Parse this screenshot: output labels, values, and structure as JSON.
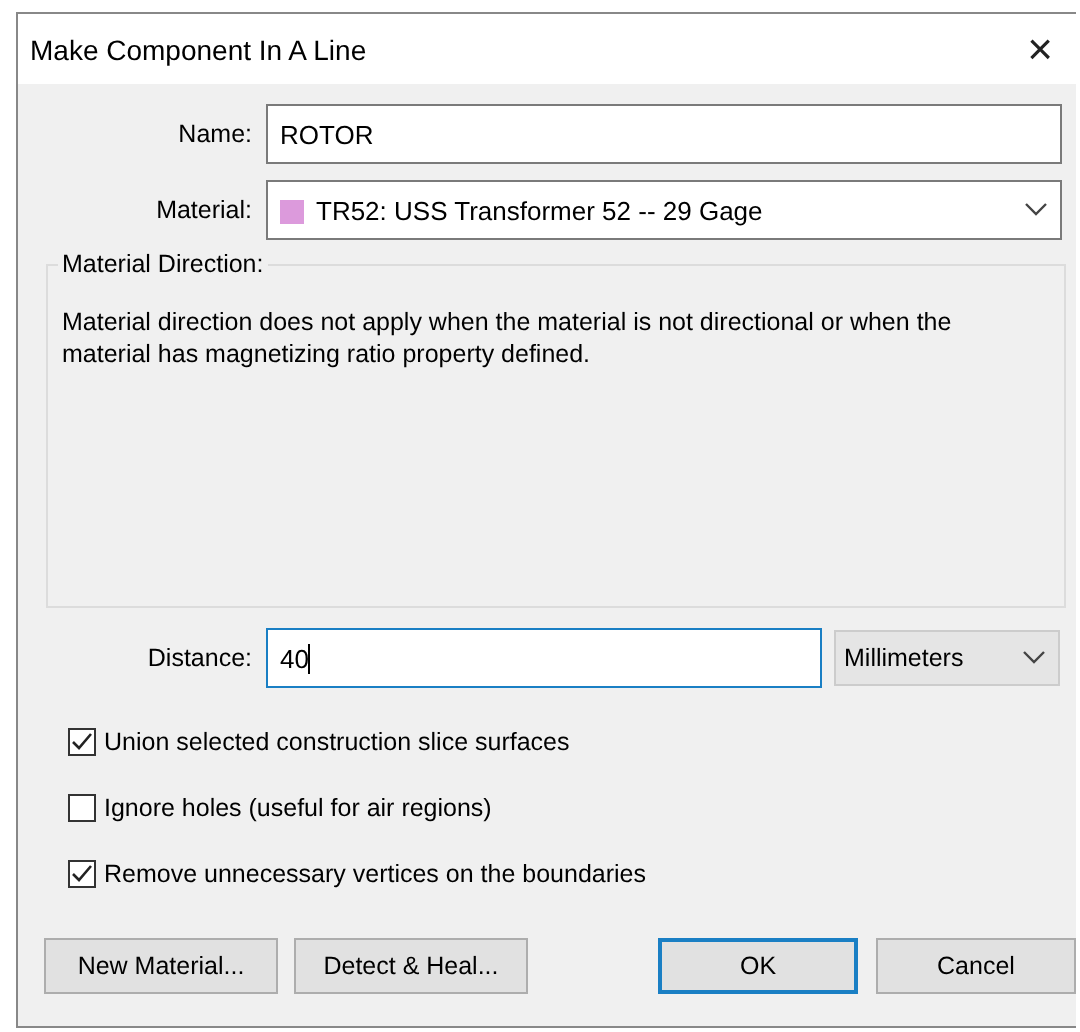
{
  "window": {
    "title": "Make Component In A Line",
    "close": "×"
  },
  "name": {
    "label": "Name:",
    "value": "ROTOR"
  },
  "material": {
    "label": "Material:",
    "value": "TR52: USS Transformer 52 -- 29 Gage",
    "color": "#dc9adc"
  },
  "material_direction": {
    "title": "Material Direction:",
    "text": "Material direction does not apply when the material is not directional or when the material has magnetizing ratio property defined."
  },
  "distance": {
    "label": "Distance:",
    "value": "40",
    "focused": true,
    "unit": "Millimeters"
  },
  "options": [
    {
      "label": "Union selected construction slice surfaces",
      "checked": true
    },
    {
      "label": "Ignore holes (useful for air regions)",
      "checked": false
    },
    {
      "label": "Remove unnecessary vertices on the boundaries",
      "checked": true
    }
  ],
  "buttons": [
    {
      "label": "New Material...",
      "default": false
    },
    {
      "label": "Detect & Heal...",
      "default": false
    },
    {
      "label": "OK",
      "default": true
    },
    {
      "label": "Cancel",
      "default": false
    }
  ]
}
